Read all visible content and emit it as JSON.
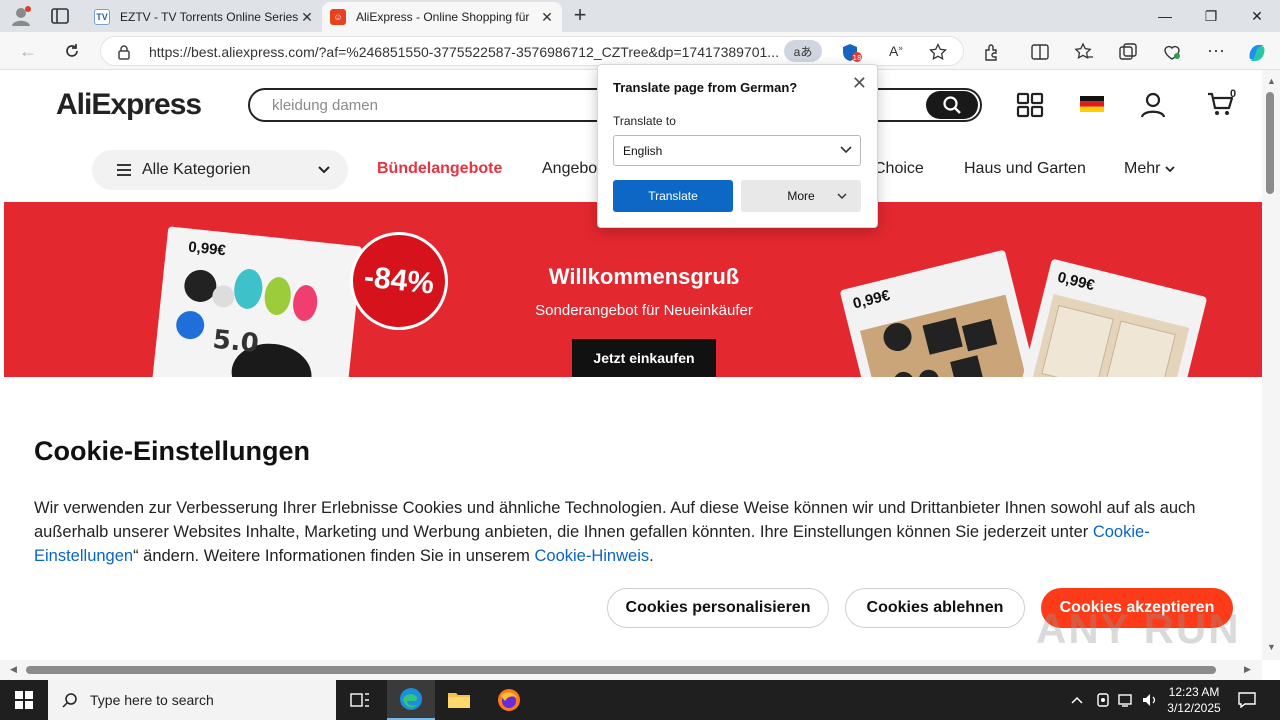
{
  "browser": {
    "tabs": [
      {
        "favicon": "eztv-favicon",
        "title": "EZTV - TV Torrents Online Series D",
        "active": false
      },
      {
        "favicon": "aliexpress-favicon",
        "title": "AliExpress - Online Shopping für",
        "active": true
      }
    ],
    "url": "https://best.aliexpress.com/?af=%246851550-3775522587-3576986712_CZTree&dp=17417389701...",
    "translate_pill": "aあ",
    "extension_badge": "18"
  },
  "translate_popup": {
    "title": "Translate page from German?",
    "label": "Translate to",
    "selected_language": "English",
    "translate_button": "Translate",
    "more_button": "More"
  },
  "header": {
    "logo": "AliExpress",
    "search_placeholder": "kleidung damen",
    "cart_count": "0"
  },
  "nav": {
    "categories_label": "Alle Kategorien",
    "links": [
      "Bündelangebote",
      "Angebo",
      "Choice",
      "Haus und Garten",
      "Mehr"
    ]
  },
  "banner": {
    "price_left": "0,99€",
    "discount": "-84%",
    "title": "Willkommensgruß",
    "subtitle": "Sonderangebot für Neueinkäufer",
    "cta": "Jetzt einkaufen",
    "price_right_1": "0,99€",
    "price_right_2": "0,99€",
    "rating": "5.0"
  },
  "cookie": {
    "heading": "Cookie-Einstellungen",
    "text_1": "Wir verwenden zur Verbesserung Ihrer Erlebnisse Cookies und ähnliche Technologien. Auf diese Weise können wir und Drittanbieter Ihnen sowohl auf als auch außerhalb unserer Websites Inhalte, Marketing und Werbung anbieten, die Ihnen gefallen könnten. Ihre Einstellungen können Sie jederzeit unter ",
    "link_1": "Cookie-Einstellungen",
    "text_2": "“ ändern. Weitere Informationen finden Sie in unserem ",
    "link_2": "Cookie-Hinweis",
    "text_3": ".",
    "btn_personalize": "Cookies personalisieren",
    "btn_reject": "Cookies ablehnen",
    "btn_accept": "Cookies akzeptieren"
  },
  "taskbar": {
    "search_placeholder": "Type here to search",
    "time": "12:23 AM",
    "date": "3/12/2025"
  },
  "watermark": "ANY RUN",
  "colors": {
    "banner_red": "#e3282f",
    "accept_orange": "#fd3b18",
    "link_blue": "#0a64c8",
    "translate_blue": "#0c67c5",
    "hot_link": "#e8323f"
  }
}
